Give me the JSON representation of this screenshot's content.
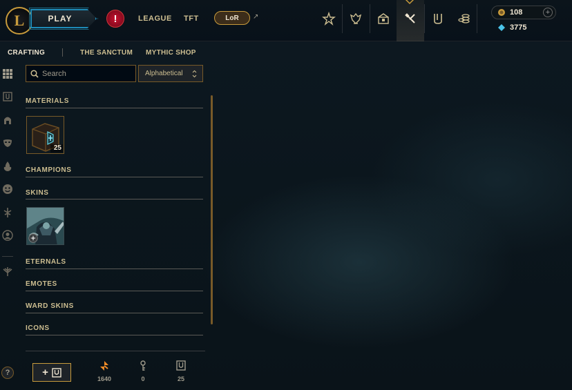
{
  "topbar": {
    "play_label": "PLAY",
    "alert_symbol": "!",
    "nav": [
      "LEAGUE",
      "TFT"
    ],
    "lor_label": "LoR",
    "external_symbol": "↗",
    "icons": [
      "challenges-icon",
      "rank-icon",
      "store-icon",
      "crafting-icon",
      "collection-icon",
      "loot-icon"
    ],
    "active_icon": "crafting-icon",
    "currency": {
      "rp": "108",
      "be": "3775",
      "plus": "+"
    }
  },
  "rail": {
    "icons": [
      "grid-icon",
      "chest-icon",
      "helmet-icon",
      "mask-icon",
      "flame-icon",
      "emote-icon",
      "ward-icon",
      "profile-icon",
      "eternals-icon"
    ],
    "help_symbol": "?"
  },
  "subnav": {
    "items": [
      "CRAFTING",
      "THE SANCTUM",
      "MYTHIC SHOP"
    ],
    "active": "CRAFTING"
  },
  "filters": {
    "search_placeholder": "Search",
    "sort_value": "Alphabetical",
    "sort_arrows": "⌃⌄"
  },
  "sections": {
    "materials": "MATERIALS",
    "champions": "CHAMPIONS",
    "skins": "SKINS",
    "eternals": "ETERNALS",
    "emotes": "EMOTES",
    "ward_skins": "WARD SKINS",
    "icons": "ICONS"
  },
  "items": {
    "material_chest": {
      "name": "hextech-chest",
      "count": "25"
    },
    "skin_shard": {
      "name": "skin-shard"
    }
  },
  "footer": {
    "add_label": "+",
    "orange_essence": "1640",
    "keys": "0",
    "chests": "25"
  },
  "colors": {
    "gold": "#c89b3c",
    "gold_light": "#cdbe91",
    "teal": "#1e8cb8",
    "orange_essence": "#f08c28",
    "blue_essence": "#4ac2e8",
    "alert_red": "#c8102e"
  }
}
